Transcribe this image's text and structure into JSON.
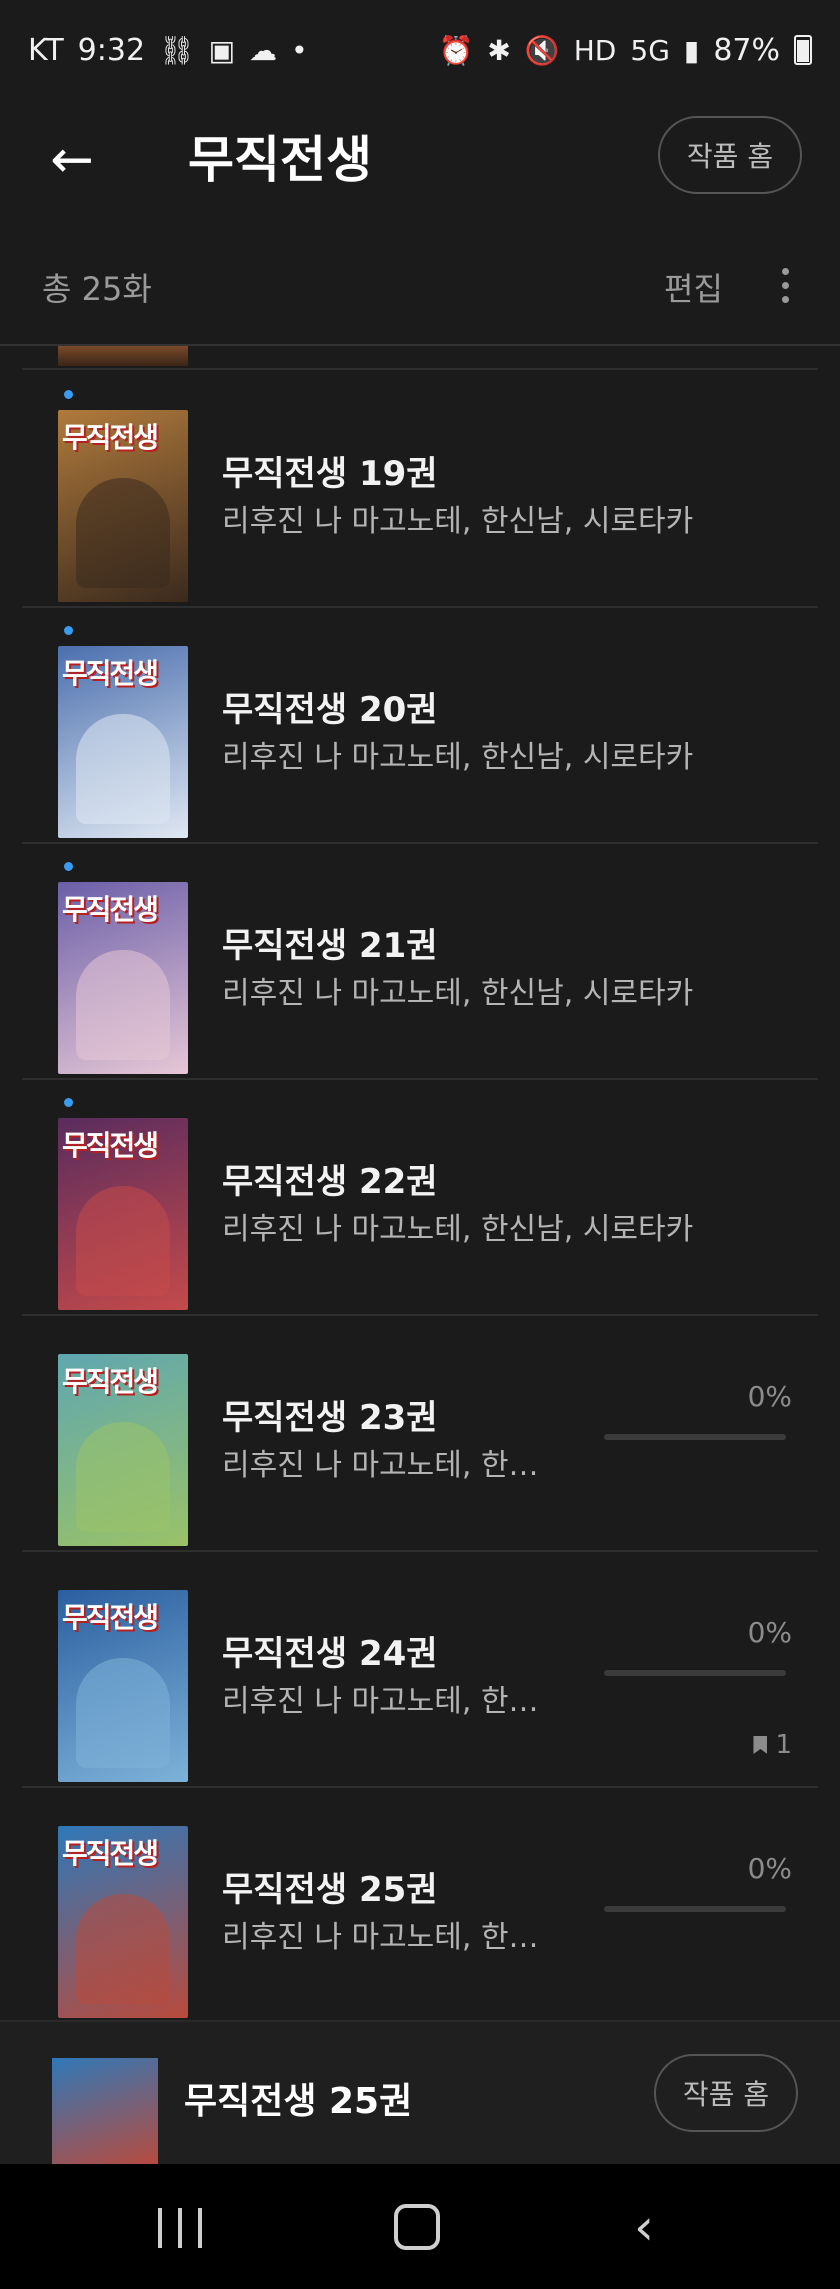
{
  "status_bar": {
    "carrier": "KT",
    "time": "9:32",
    "battery": "87%",
    "network": "5G"
  },
  "app_bar": {
    "back_icon": "arrow-left-icon",
    "title": "무직전생",
    "home_button": "작품 홈"
  },
  "sub_bar": {
    "total": "총 25화",
    "edit": "편집",
    "more_icon": "more-vertical-icon"
  },
  "accent_color": "#3a9cf1",
  "items": [
    {
      "title": "무직전생 19권",
      "author": "리후진 나 마고노테, 한신남, 시로타카",
      "new": true,
      "progress": null,
      "bookmarks": null,
      "cover_color": "#b07a3c",
      "cover_color2": "#3b2a1d"
    },
    {
      "title": "무직전생 20권",
      "author": "리후진 나 마고노테, 한신남, 시로타카",
      "new": true,
      "progress": null,
      "bookmarks": null,
      "cover_color": "#4b6fae",
      "cover_color2": "#dfe7f2"
    },
    {
      "title": "무직전생 21권",
      "author": "리후진 나 마고노테, 한신남, 시로타카",
      "new": true,
      "progress": null,
      "bookmarks": null,
      "cover_color": "#6b5fa8",
      "cover_color2": "#e6c7d6"
    },
    {
      "title": "무직전생 22권",
      "author": "리후진 나 마고노테, 한신남, 시로타카",
      "new": true,
      "progress": null,
      "bookmarks": null,
      "cover_color": "#5a2c5e",
      "cover_color2": "#c44a4a"
    },
    {
      "title": "무직전생 23권",
      "author": "리후진 나 마고노테, 한신...",
      "new": false,
      "progress": "0%",
      "bookmarks": null,
      "cover_color": "#5fa7b0",
      "cover_color2": "#9ac267"
    },
    {
      "title": "무직전생 24권",
      "author": "리후진 나 마고노테, 한신...",
      "new": false,
      "progress": "0%",
      "bookmarks": "1",
      "cover_color": "#2a5fa0",
      "cover_color2": "#7fb2d8"
    },
    {
      "title": "무직전생 25권",
      "author": "리후진 나 마고노테, 한신...",
      "new": false,
      "progress": "0%",
      "bookmarks": null,
      "cover_color": "#2f78b8",
      "cover_color2": "#b84a3c"
    }
  ],
  "cover_text": "무직전생",
  "mini_player": {
    "title": "무직전생 25권",
    "home_button": "작품 홈"
  }
}
